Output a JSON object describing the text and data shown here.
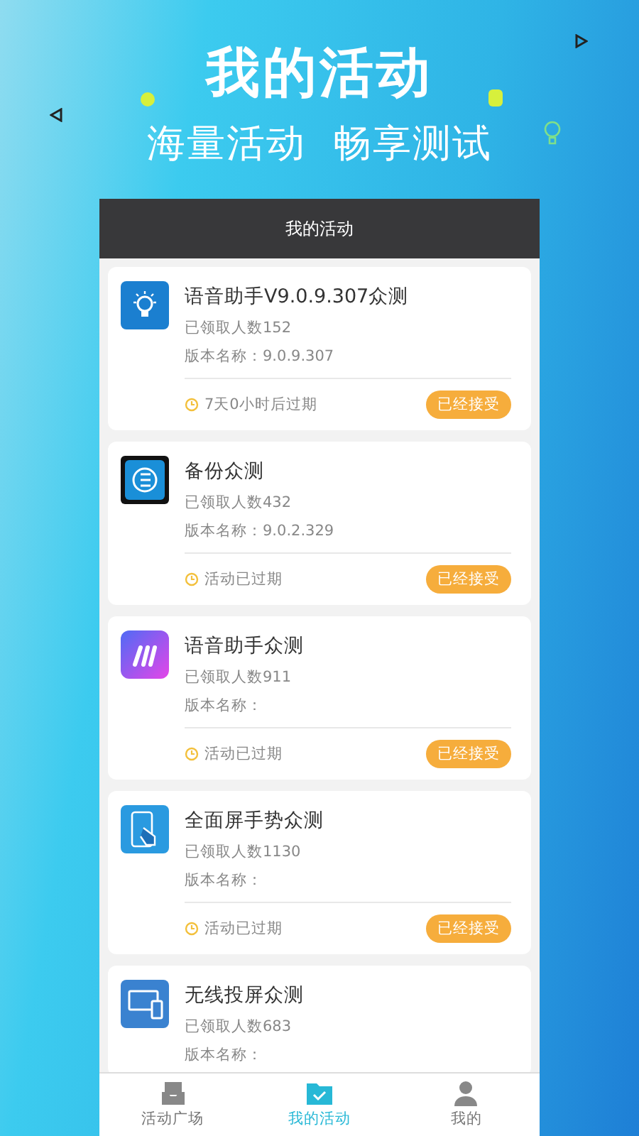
{
  "banner": {
    "title": "我的活动",
    "subtitle": "海量活动  畅享测试"
  },
  "header": {
    "title": "我的活动"
  },
  "activities": [
    {
      "kind": "bulb",
      "title": "语音助手V9.0.9.307众测",
      "participants": "已领取人数152",
      "version": "版本名称：9.0.9.307",
      "expiry": "7天0小时后过期",
      "action": "已经接受"
    },
    {
      "kind": "backup",
      "title": "备份众测",
      "participants": "已领取人数432",
      "version": "版本名称：9.0.2.329",
      "expiry": "活动已过期",
      "action": "已经接受"
    },
    {
      "kind": "assistant",
      "title": "语音助手众测",
      "participants": "已领取人数911",
      "version": "版本名称：",
      "expiry": "活动已过期",
      "action": "已经接受"
    },
    {
      "kind": "gesture",
      "title": "全面屏手势众测",
      "participants": "已领取人数1130",
      "version": "版本名称：",
      "expiry": "活动已过期",
      "action": "已经接受"
    },
    {
      "kind": "cast",
      "title": "无线投屏众测",
      "participants": "已领取人数683",
      "version": "版本名称："
    }
  ],
  "tabs": [
    {
      "kind": "inbox",
      "label": "活动广场",
      "selected": false
    },
    {
      "kind": "folder",
      "label": "我的活动",
      "selected": true
    },
    {
      "kind": "person",
      "label": "我的",
      "selected": false
    }
  ]
}
